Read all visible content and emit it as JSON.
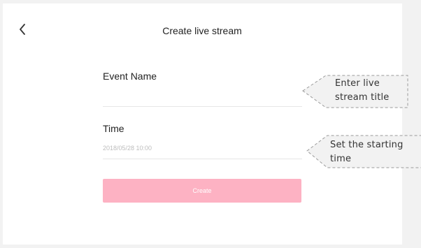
{
  "header": {
    "title": "Create live stream",
    "back_icon": "chevron-left-icon"
  },
  "form": {
    "event_name_label": "Event Name",
    "event_name_value": "",
    "time_label": "Time",
    "time_value": "2018/05/28 10:00",
    "create_label": "Create"
  },
  "annotations": {
    "event_name": {
      "line1": "Enter live",
      "line2": "stream title"
    },
    "time": {
      "line1": "Set the starting",
      "line2": "time"
    }
  },
  "colors": {
    "primary_button": "#fdb2c3",
    "background": "#f2f2f2",
    "panel": "#ffffff"
  }
}
